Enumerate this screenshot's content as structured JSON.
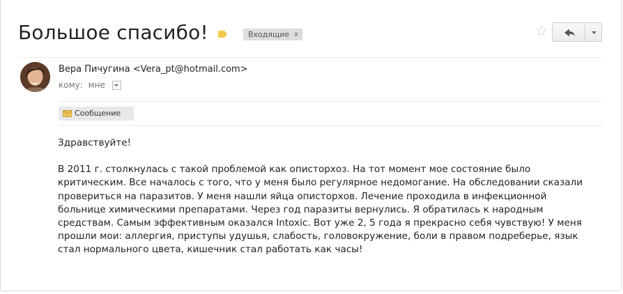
{
  "email": {
    "subject": "Большое спасибо!",
    "label_chip": "Входящие",
    "label_chip_close": "x",
    "sender": "Вера Пичугина <Vera_pt@hotmail.com>",
    "to_prefix": "кому:",
    "to_value": "мне",
    "attachment_chip": "Сообщение",
    "body": {
      "greeting": "Здравствуйте!",
      "paragraph": "В 2011 г. столкнулась с такой проблемой как описторхоз. На тот момент мое состояние было критическим. Все началось с того, что у меня было регулярное недомогание. На обследовании сказали провериться на паразитов. У меня нашли яйца описторхов. Лечение проходила в инфекционной больнице химическими препаратами. Через год паразиты вернулись. Я обратилась к народным средствам. Самым эффективным оказался Intoxic. Вот уже 2, 5 года я прекрасно себя чувствую! У меня прошли мои: аллергия, приступы удушья, слабость, головокружение, боли в правом подреберье, язык стал нормального цвета, кишечник стал работать как часы!"
    }
  },
  "icons": {
    "label": "label-tag-icon",
    "star": "star-icon",
    "reply": "reply-arrow-icon",
    "more": "chevron-down-icon",
    "envelope": "envelope-icon"
  },
  "colors": {
    "label_tag": "#f2c94c",
    "chip_bg": "#dddddd",
    "star": "#c8c8c8"
  }
}
